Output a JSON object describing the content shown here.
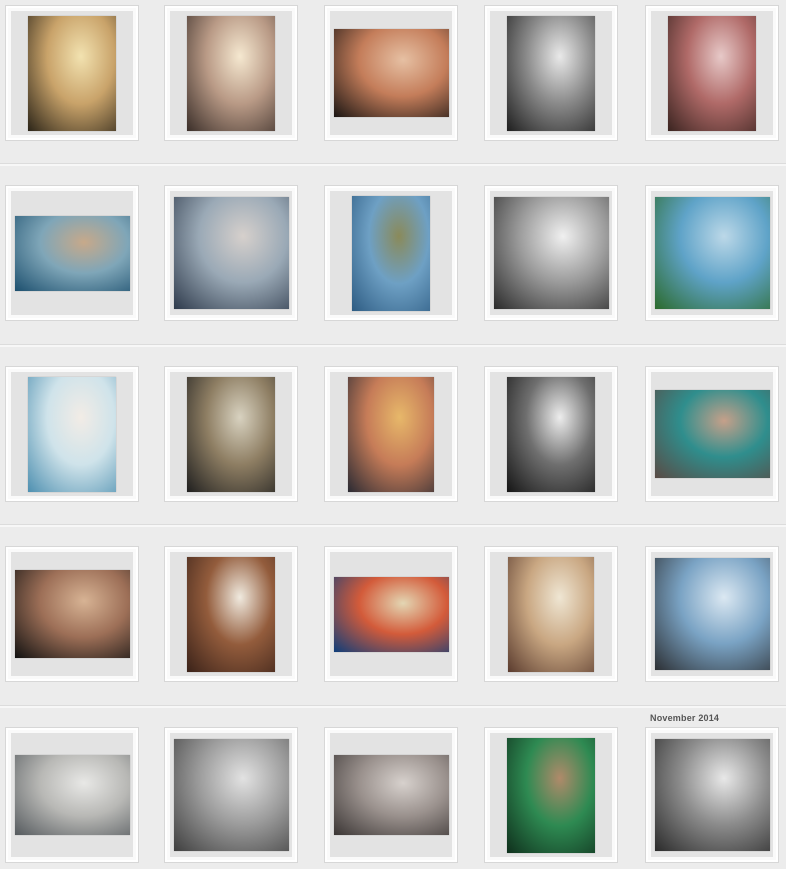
{
  "month_label": "November 2014",
  "rows": [
    {
      "tiles": [
        {
          "shape": "portrait-tall",
          "c1": "#2b2418",
          "c2": "#c9a36a",
          "c3": "#f2e2b0"
        },
        {
          "shape": "portrait-tall",
          "c1": "#3a2e29",
          "c2": "#b99a86",
          "c3": "#f5e8d0"
        },
        {
          "shape": "landscape",
          "c1": "#1a1513",
          "c2": "#c47d5a",
          "c3": "#e6c0a3"
        },
        {
          "shape": "portrait-tall",
          "c1": "#1e1e1e",
          "c2": "#8a8a8a",
          "c3": "#e9e9e9"
        },
        {
          "shape": "portrait-tall",
          "c1": "#3a2420",
          "c2": "#b06a68",
          "c3": "#e7c9c8"
        }
      ]
    },
    {
      "tiles": [
        {
          "shape": "landscape-short",
          "c1": "#1c4f6e",
          "c2": "#7fa6b8",
          "c3": "#c7a98a"
        },
        {
          "shape": "square",
          "c1": "#2e3a4b",
          "c2": "#9aa9b6",
          "c3": "#d6d0cc"
        },
        {
          "shape": "portrait",
          "c1": "#2d5b82",
          "c2": "#6ea0c4",
          "c3": "#8a8a5a"
        },
        {
          "shape": "square",
          "c1": "#2a2a2a",
          "c2": "#9b9b9b",
          "c3": "#f0f0f0"
        },
        {
          "shape": "square",
          "c1": "#2b6a2b",
          "c2": "#5fa3c8",
          "c3": "#bcd8e8"
        }
      ]
    },
    {
      "tiles": [
        {
          "shape": "portrait-tall",
          "c1": "#4d8fb0",
          "c2": "#cfe3ea",
          "c3": "#f2ece6"
        },
        {
          "shape": "portrait-tall",
          "c1": "#1f1f1f",
          "c2": "#8e7e63",
          "c3": "#d8d2c0"
        },
        {
          "shape": "portrait-narrow",
          "c1": "#2a2a33",
          "c2": "#c67c58",
          "c3": "#e7b86a"
        },
        {
          "shape": "portrait-tall",
          "c1": "#151515",
          "c2": "#6f6f6f",
          "c3": "#ededed"
        },
        {
          "shape": "landscape",
          "c1": "#5a4a44",
          "c2": "#2f8e8d",
          "c3": "#c6a08a"
        }
      ]
    },
    {
      "tiles": [
        {
          "shape": "landscape",
          "c1": "#111111",
          "c2": "#9d6f57",
          "c3": "#d7b394"
        },
        {
          "shape": "portrait-tall",
          "c1": "#3a2219",
          "c2": "#935c3c",
          "c3": "#f0eadf"
        },
        {
          "shape": "landscape-short",
          "c1": "#0d3d7a",
          "c2": "#d35b3a",
          "c3": "#e3d6b3"
        },
        {
          "shape": "portrait-narrow",
          "c1": "#5a3b2e",
          "c2": "#c9a782",
          "c3": "#efe6d3"
        },
        {
          "shape": "square",
          "c1": "#2c2f33",
          "c2": "#7aa3c4",
          "c3": "#dbe8f2"
        }
      ]
    },
    {
      "tiles": [
        {
          "shape": "landscape-mid",
          "c1": "#555a5e",
          "c2": "#b8b8b5",
          "c3": "#e8e8e6"
        },
        {
          "shape": "square",
          "c1": "#3f3f3f",
          "c2": "#9c9c9c",
          "c3": "#e2e2e2"
        },
        {
          "shape": "landscape-mid",
          "c1": "#3a3534",
          "c2": "#9a918d",
          "c3": "#d7d1cd"
        },
        {
          "shape": "portrait-tall",
          "c1": "#0f2f1c",
          "c2": "#2e8a52",
          "c3": "#b08a6a"
        },
        {
          "shape": "square",
          "c1": "#2a2a2a",
          "c2": "#8c8c8c",
          "c3": "#e8e8e8"
        }
      ]
    }
  ]
}
